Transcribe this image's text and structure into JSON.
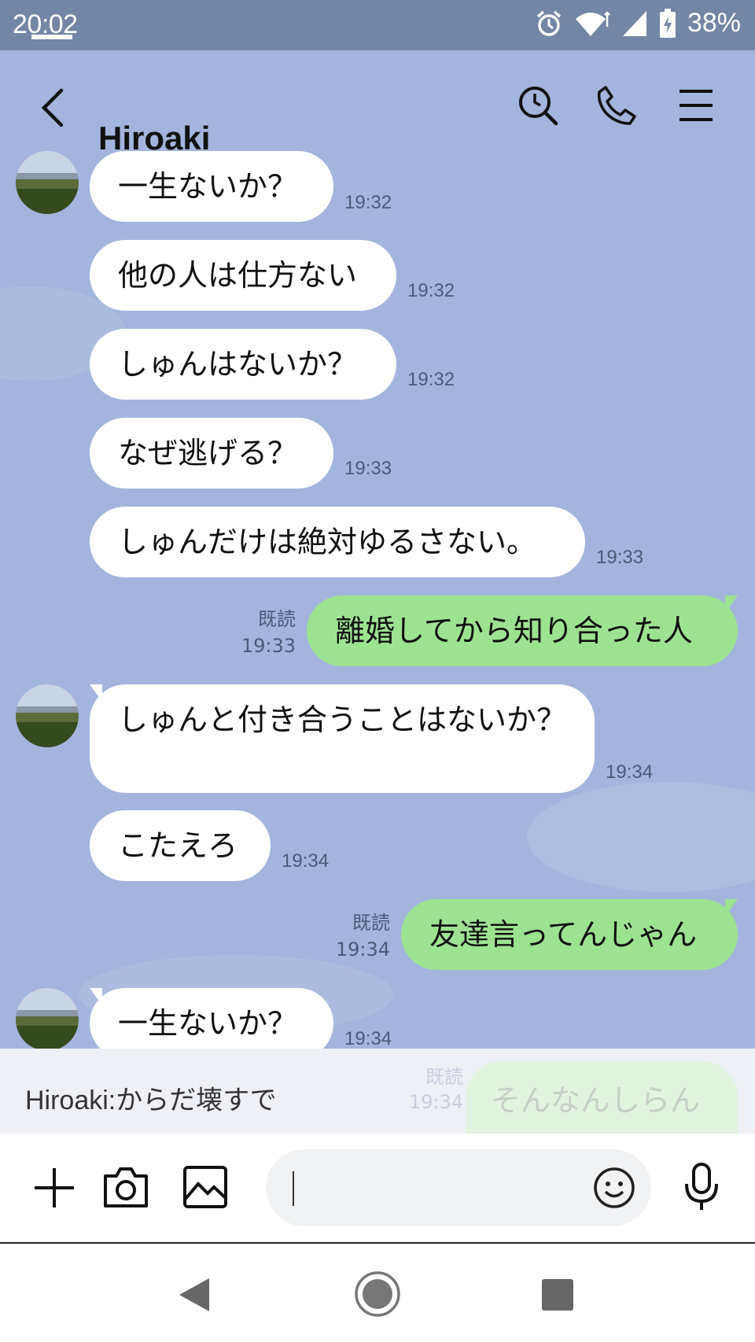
{
  "status_bar": {
    "time": "20:02",
    "battery": "38%"
  },
  "header": {
    "contact_name": "Hiroaki"
  },
  "messages": [
    {
      "text": "一生ないか？",
      "time": "19:32"
    },
    {
      "text": "他の人は仕方ない",
      "time": "19:32"
    },
    {
      "text": "しゅんはないか？",
      "time": "19:32"
    },
    {
      "text": "なぜ逃げる？",
      "time": "19:33"
    },
    {
      "text": "しゅんだけは絶対ゆるさない。",
      "time": "19:33"
    },
    {
      "text": "離婚してから知り合った人",
      "time": "19:33",
      "read": "既読"
    },
    {
      "text": "しゅんと付き合うことはないか？",
      "time": "19:34"
    },
    {
      "text": "こたえろ",
      "time": "19:34"
    },
    {
      "text": "友達言ってんじゃん",
      "time": "19:34",
      "read": "既読"
    },
    {
      "text": "一生ないか？",
      "time": "19:34"
    }
  ],
  "notification": {
    "preview": "Hiroaki:からだ壊すで",
    "ghost_read": "既読",
    "ghost_time": "19:34",
    "ghost_text": "そんなんしらん"
  },
  "input": {
    "placeholder": ""
  },
  "colors": {
    "chat_background": "#a3b5dd",
    "outgoing_bubble": "#9de291",
    "incoming_bubble": "#ffffff"
  }
}
